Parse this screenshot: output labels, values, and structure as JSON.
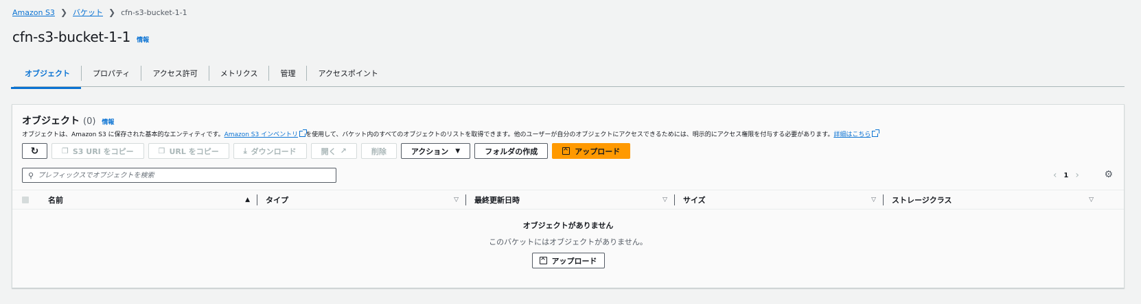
{
  "breadcrumb": {
    "root": "Amazon S3",
    "buckets": "バケット",
    "current": "cfn-s3-bucket-1-1"
  },
  "page": {
    "title": "cfn-s3-bucket-1-1",
    "info": "情報"
  },
  "tabs": [
    {
      "label": "オブジェクト",
      "active": true
    },
    {
      "label": "プロパティ",
      "active": false
    },
    {
      "label": "アクセス許可",
      "active": false
    },
    {
      "label": "メトリクス",
      "active": false
    },
    {
      "label": "管理",
      "active": false
    },
    {
      "label": "アクセスポイント",
      "active": false
    }
  ],
  "objects_panel": {
    "title": "オブジェクト",
    "count": "(0)",
    "info": "情報",
    "desc_prefix": "オブジェクトは、Amazon S3 に保存された基本的なエンティティです。",
    "desc_link1": "Amazon S3 インベントリ",
    "desc_middle": "を使用して、バケット内のすべてのオブジェクトのリストを取得できます。他のユーザーが自分のオブジェクトにアクセスできるためには、明示的にアクセス権限を付与する必要があります。",
    "desc_link2": "詳細はこちら"
  },
  "toolbar": {
    "copy_s3_uri": "S3 URI をコピー",
    "copy_url": "URL をコピー",
    "download": "ダウンロード",
    "open": "開く",
    "delete": "削除",
    "actions": "アクション",
    "create_folder": "フォルダの作成",
    "upload": "アップロード"
  },
  "search": {
    "placeholder": "プレフィックスでオブジェクトを検索"
  },
  "pagination": {
    "page": "1"
  },
  "table": {
    "columns": [
      "名前",
      "タイプ",
      "最終更新日時",
      "サイズ",
      "ストレージクラス"
    ]
  },
  "empty": {
    "title": "オブジェクトがありません",
    "subtitle": "このバケットにはオブジェクトがありません。",
    "upload": "アップロード"
  },
  "colors": {
    "link": "#0972d3",
    "primary_button": "#ff9900",
    "background": "#f2f3f3"
  }
}
